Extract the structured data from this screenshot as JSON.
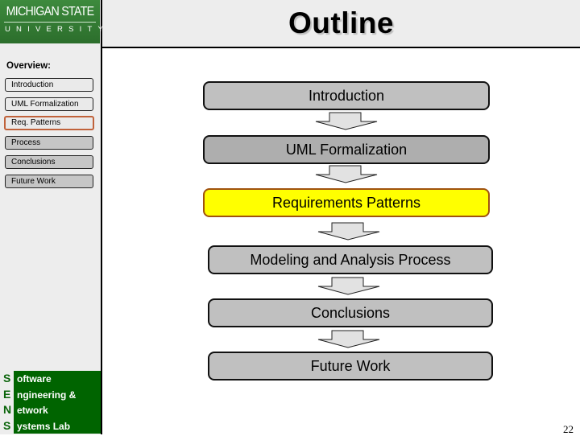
{
  "slide": {
    "title": "Outline",
    "page_number": "22"
  },
  "logo": {
    "line1": "MICHIGAN STATE",
    "line2": "UNIVERSITY",
    "color": "#2f7a2f"
  },
  "sidebar": {
    "overview_label": "Overview:",
    "items": [
      {
        "label": "Introduction",
        "state": "light"
      },
      {
        "label": "UML Formalization",
        "state": "light"
      },
      {
        "label": "Req. Patterns",
        "state": "active"
      },
      {
        "label": "Process",
        "state": "dark"
      },
      {
        "label": "Conclusions",
        "state": "dark"
      },
      {
        "label": "Future Work",
        "state": "dark"
      }
    ],
    "active_border_color": "#c0623b"
  },
  "lab": {
    "rows": [
      {
        "letter": "S",
        "word": "oftware"
      },
      {
        "letter": "E",
        "word": "ngineering &"
      },
      {
        "letter": "N",
        "word": "etwork"
      },
      {
        "letter": "S",
        "word": "ystems Lab"
      }
    ],
    "color": "#006400"
  },
  "flow": {
    "steps": [
      {
        "label": "Introduction",
        "style": "g1"
      },
      {
        "label": "UML Formalization",
        "style": "g2"
      },
      {
        "label": "Requirements Patterns",
        "style": "hl"
      },
      {
        "label": "Modeling and Analysis Process",
        "style": "g1"
      },
      {
        "label": "Conclusions",
        "style": "g1"
      },
      {
        "label": "Future Work",
        "style": "g1"
      }
    ],
    "highlight_color": "#ffff00"
  }
}
